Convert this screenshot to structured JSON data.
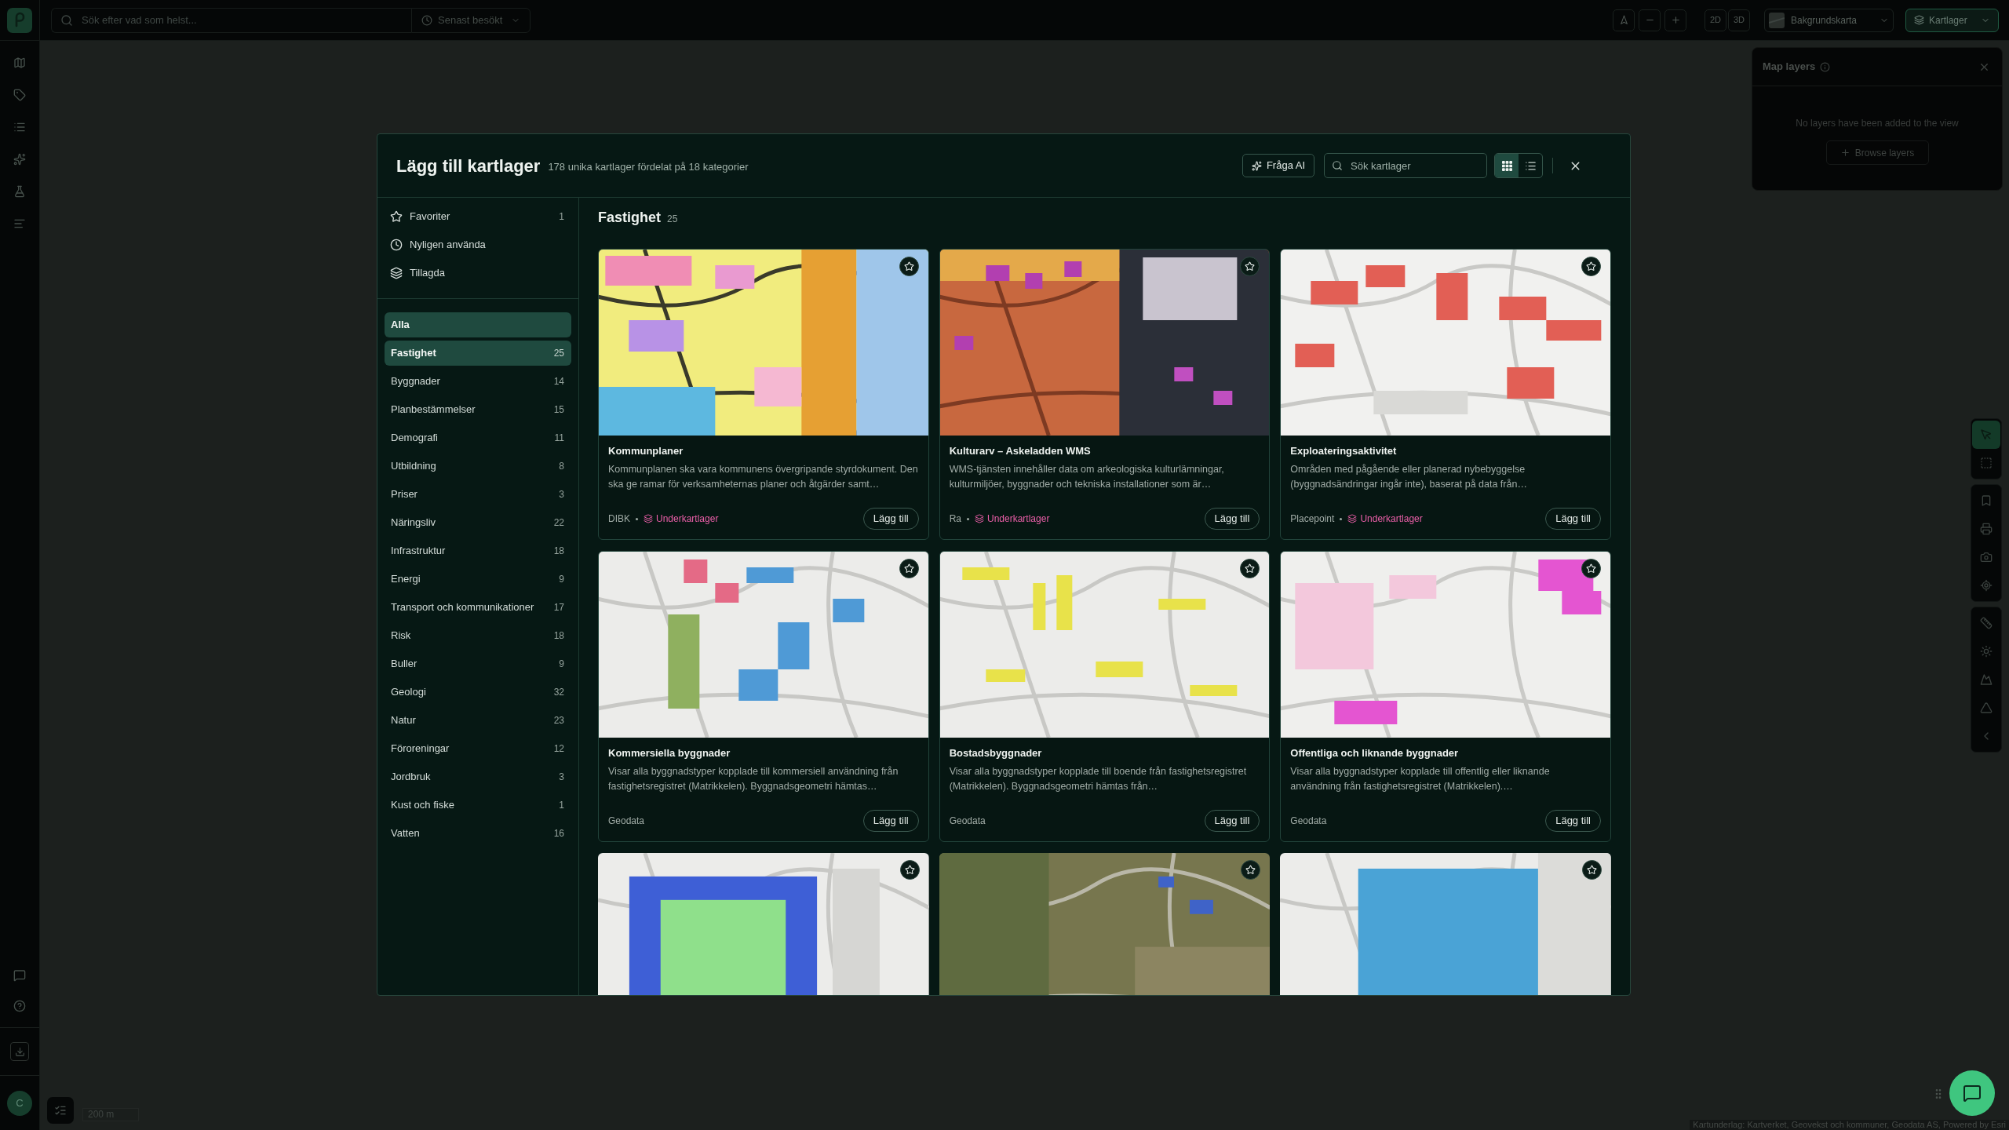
{
  "top_bar": {
    "search": {
      "placeholder": "Sök efter vad som helst..."
    },
    "recent_button": "Senast besökt",
    "view_modes": [
      "2D",
      "3D"
    ],
    "basemap_button": "Bakgrundskarta",
    "layers_button": {
      "label": "Kartlager",
      "active": true
    }
  },
  "left_rail": {
    "avatar": "C"
  },
  "map": {
    "scale": "200 m",
    "attribution": "Kartunderlag: Kartverket, Geovekst och kommuner, Geodata AS, Powered by Esri"
  },
  "map_tool_groups": [
    [
      {
        "kind": "pointer",
        "selected": true
      },
      {
        "kind": "area_select",
        "selected": false
      }
    ],
    [
      {
        "kind": "bookmark",
        "selected": false
      },
      {
        "kind": "printer",
        "selected": false
      },
      {
        "kind": "camera",
        "selected": false
      },
      {
        "kind": "locate",
        "selected": false
      }
    ],
    [
      {
        "kind": "measure",
        "selected": false
      },
      {
        "kind": "sun",
        "selected": false
      },
      {
        "kind": "terrain",
        "selected": false
      },
      {
        "kind": "viewshed",
        "selected": false
      },
      {
        "kind": "collapse",
        "selected": false
      }
    ]
  ],
  "map_layers_panel": {
    "title": "Map layers",
    "empty_text": "No layers have been added to the view",
    "browse_button": "Browse layers"
  },
  "dialog": {
    "title": "Lägg till kartlager",
    "subtitle": "178 unika kartlager fördelat på 18 kategorier",
    "ask_ai_button": "Fråga AI",
    "search": {
      "placeholder": "Sök kartlager"
    },
    "view_toggle": [
      {
        "kind": "grid",
        "selected": true
      },
      {
        "kind": "list",
        "selected": false
      }
    ]
  },
  "sidebar": {
    "shortcuts": [
      {
        "kind": "favorites",
        "label": "Favoriter",
        "count": "1"
      },
      {
        "kind": "recent",
        "label": "Nyligen använda"
      },
      {
        "kind": "added",
        "label": "Tillagda"
      }
    ],
    "categories": [
      {
        "label": "Alla",
        "selected": true
      },
      {
        "label": "Fastighet",
        "count": "25",
        "selected": true
      },
      {
        "label": "Byggnader",
        "count": "14",
        "selected": false
      },
      {
        "label": "Planbestämmelser",
        "count": "15",
        "selected": false
      },
      {
        "label": "Demografi",
        "count": "11",
        "selected": false
      },
      {
        "label": "Utbildning",
        "count": "8",
        "selected": false
      },
      {
        "label": "Priser",
        "count": "3",
        "selected": false
      },
      {
        "label": "Näringsliv",
        "count": "22",
        "selected": false
      },
      {
        "label": "Infrastruktur",
        "count": "18",
        "selected": false
      },
      {
        "label": "Energi",
        "count": "9",
        "selected": false
      },
      {
        "label": "Transport och kommunikationer",
        "count": "17",
        "selected": false
      },
      {
        "label": "Risk",
        "count": "18",
        "selected": false
      },
      {
        "label": "Buller",
        "count": "9",
        "selected": false
      },
      {
        "label": "Geologi",
        "count": "32",
        "selected": false
      },
      {
        "label": "Natur",
        "count": "23",
        "selected": false
      },
      {
        "label": "Föroreningar",
        "count": "12",
        "selected": false
      },
      {
        "label": "Jordbruk",
        "count": "3",
        "selected": false
      },
      {
        "label": "Kust och fiske",
        "count": "1",
        "selected": false
      },
      {
        "label": "Vatten",
        "count": "16",
        "selected": false
      }
    ]
  },
  "content": {
    "heading": "Fastighet",
    "count": "25",
    "cards": [
      {
        "kind": "full",
        "title": "Kommunplaner",
        "description": "Kommunplanen ska vara kommunens övergripande styrdokument. Den ska ge ramar för verksamheternas planer och åtgärder samt…",
        "source": "DIBK",
        "sublayers": "Underkartlager",
        "button": "Lägg till"
      },
      {
        "kind": "full",
        "title": "Kulturarv – Askeladden WMS",
        "description": "WMS-tjänsten innehåller data om arkeologiska kulturlämningar, kulturmiljöer, byggnader och tekniska installationer som är…",
        "source": "Ra",
        "sublayers": "Underkartlager",
        "button": "Lägg till"
      },
      {
        "kind": "full",
        "title": "Exploateringsaktivitet",
        "description": "Områden med pågående eller planerad nybebyggelse (byggnadsändringar ingår inte), baserat på data från…",
        "source": "Placepoint",
        "sublayers": "Underkartlager",
        "button": "Lägg till"
      },
      {
        "kind": "full",
        "title": "Kommersiella byggnader",
        "description": "Visar alla byggnadstyper kopplade till kommersiell användning från fastighetsregistret (Matrikkelen). Byggnadsgeometri hämtas…",
        "source": "Geodata",
        "button": "Lägg till"
      },
      {
        "kind": "full",
        "title": "Bostadsbyggnader",
        "description": "Visar alla byggnadstyper kopplade till boende från fastighetsregistret (Matrikkelen). Byggnadsgeometri hämtas från…",
        "source": "Geodata",
        "button": "Lägg till"
      },
      {
        "kind": "full",
        "title": "Offentliga och liknande byggnader",
        "description": "Visar alla byggnadstyper kopplade till offentlig eller liknande användning från fastighetsregistret (Matrikkelen).…",
        "source": "Geodata",
        "button": "Lägg till"
      },
      {
        "kind": "image_only"
      },
      {
        "kind": "image_only"
      },
      {
        "kind": "image_only"
      }
    ]
  }
}
